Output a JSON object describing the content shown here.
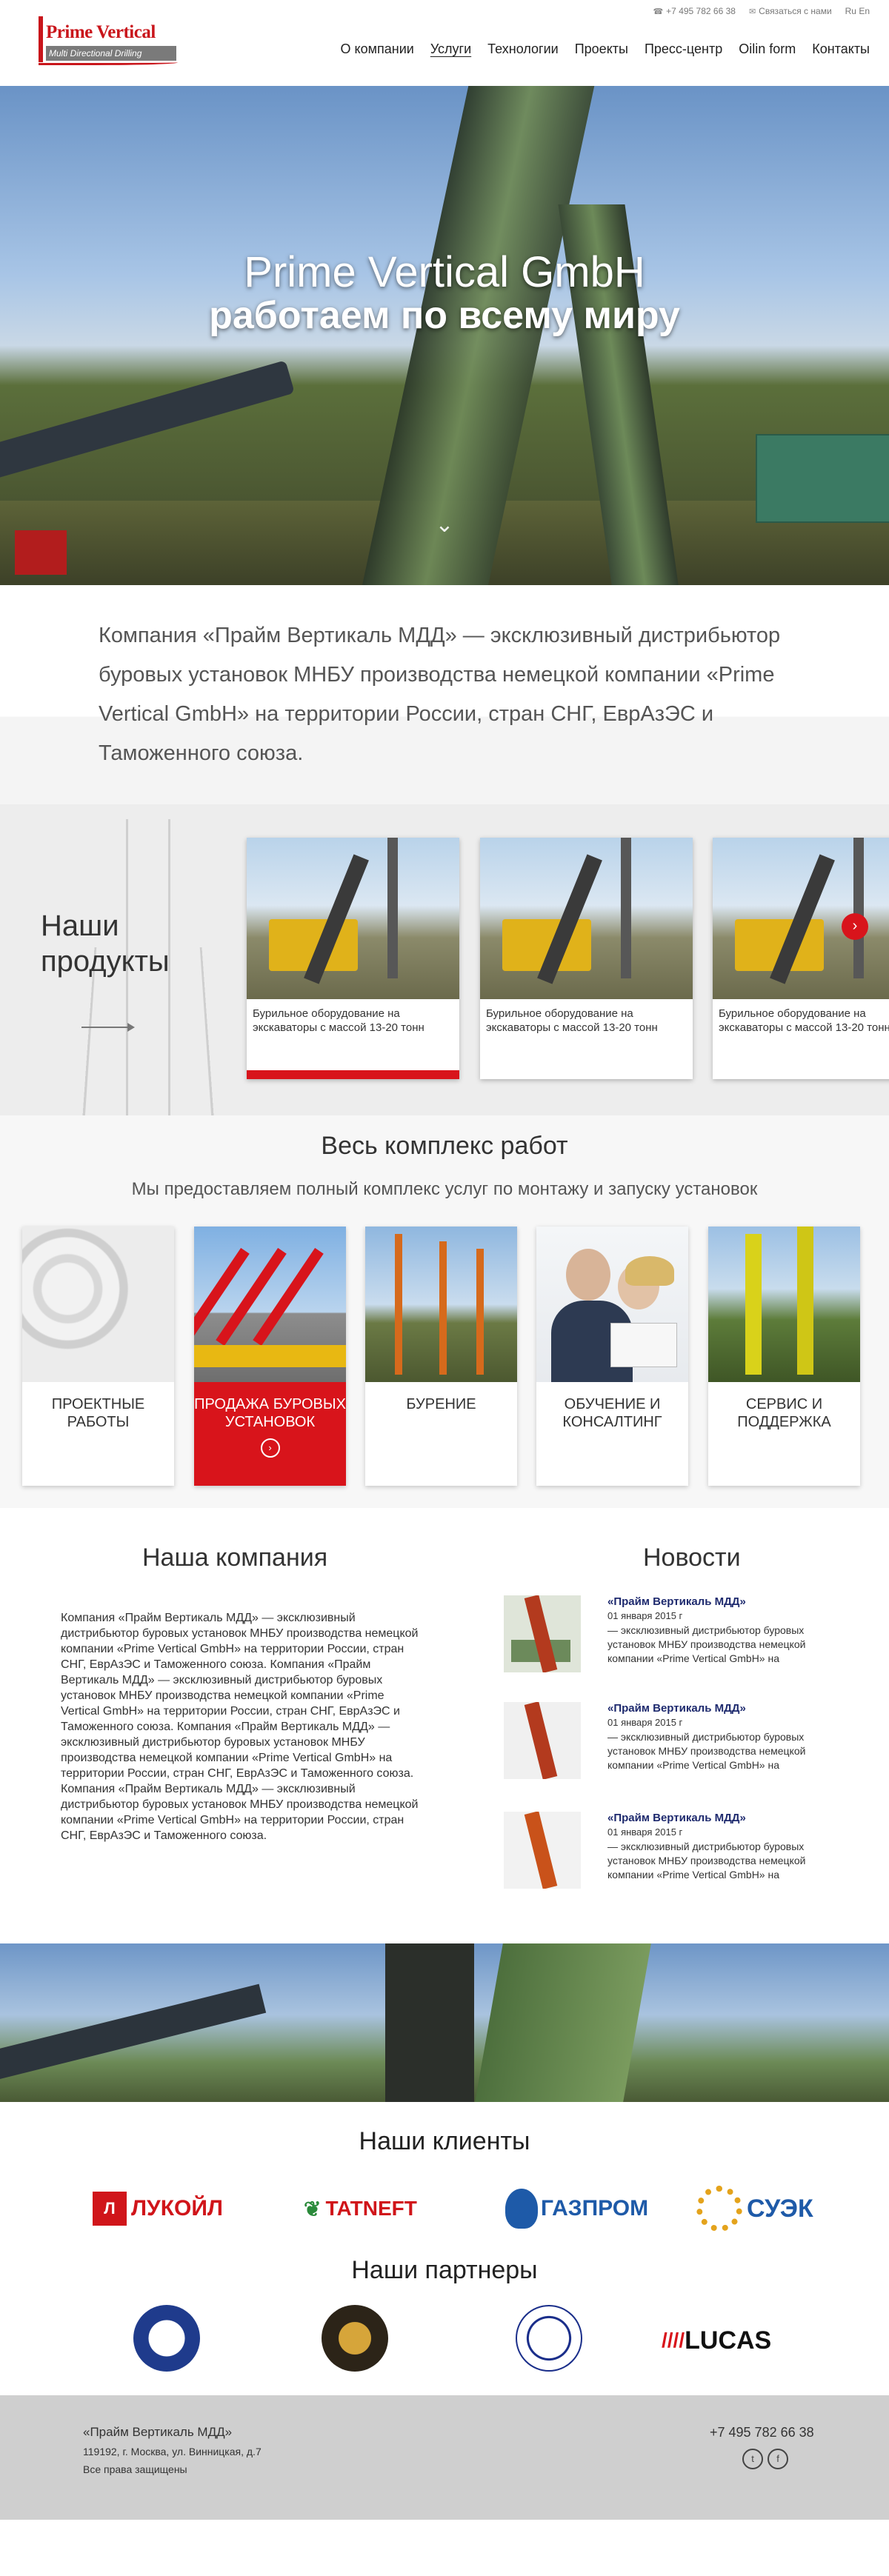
{
  "header": {
    "logo_title": "Prime Vertical",
    "logo_sub": "Multi Directional Drilling",
    "phone": "+7 495 782 66 38",
    "contact": "Связаться с нами",
    "lang": "Ru En",
    "nav": [
      "О компании",
      "Услуги",
      "Технологии",
      "Проекты",
      "Пресс-центр",
      "Oilin form",
      "Контакты"
    ],
    "active_nav_index": 1
  },
  "hero": {
    "title": "Prime Vertical GmbH",
    "subtitle": "работаем по всему миру"
  },
  "intro": {
    "text": "Компания «Прайм Вертикаль МДД» — эксклюзивный дистрибьютор буровых установок МНБУ производства немецкой компании «Prime Vertical GmbH» на территории России, стран СНГ, ЕврАзЭС и Таможенного союза."
  },
  "products": {
    "heading": "Наши продукты",
    "cards": [
      {
        "text": "Бурильное оборудование на экскаваторы с массой 13-20 тонн"
      },
      {
        "text": "Бурильное оборудование на экскаваторы с массой 13-20 тонн"
      },
      {
        "text": "Бурильное оборудование на экскаваторы с массой 13-20 тонн"
      }
    ]
  },
  "services": {
    "heading": "Весь комплекс работ",
    "lead": "Мы предоставляем полный комплекс услуг по монтажу и запуску установок",
    "cards": [
      {
        "label": "ПРОЕКТНЫЕ РАБОТЫ"
      },
      {
        "label": "ПРОДАЖА БУРОВЫХ УСТАНОВОК"
      },
      {
        "label": "БУРЕНИЕ"
      },
      {
        "label": "ОБУЧЕНИЕ И КОНСАЛТИНГ"
      },
      {
        "label": "СЕРВИС И ПОДДЕРЖКА"
      }
    ]
  },
  "company": {
    "heading": "Наша компания",
    "text": "Компания «Прайм Вертикаль МДД» — эксклюзивный дистрибьютор буровых установок МНБУ производства немецкой компании «Prime Vertical GmbH» на территории России, стран СНГ, ЕврАзЭС и Таможенного союза. Компания «Прайм Вертикаль МДД» — эксклюзивный дистрибьютор буровых установок МНБУ производства немецкой компании «Prime Vertical GmbH» на территории России, стран СНГ, ЕврАзЭС и Таможенного союза. Компания «Прайм Вертикаль МДД» — эксклюзивный дистрибьютор буровых установок МНБУ производства немецкой компании «Prime Vertical GmbH» на территории России, стран СНГ, ЕврАзЭС и Таможенного союза. Компания «Прайм Вертикаль МДД» — эксклюзивный дистрибьютор буровых установок МНБУ производства немецкой компании «Prime Vertical GmbH» на территории России, стран СНГ, ЕврАзЭС и Таможенного союза."
  },
  "news": {
    "heading": "Новости",
    "items": [
      {
        "title": "«Прайм Вертикаль МДД»",
        "date": "01 января 2015 г",
        "body": "— эксклюзивный дистрибьютор буровых установок МНБУ производства немецкой компании «Prime Vertical GmbH» на"
      },
      {
        "title": "«Прайм Вертикаль МДД»",
        "date": "01 января 2015 г",
        "body": "— эксклюзивный дистрибьютор буровых установок МНБУ производства немецкой компании «Prime Vertical GmbH» на"
      },
      {
        "title": "«Прайм Вертикаль МДД»",
        "date": "01 января 2015 г",
        "body": "— эксклюзивный дистрибьютор буровых установок МНБУ производства немецкой компании «Prime Vertical GmbH» на"
      }
    ]
  },
  "clients": {
    "heading": "Наши клиенты",
    "logos": [
      "ЛУКОЙЛ",
      "TATNEFT",
      "ГАЗПРОМ",
      "СУЭК"
    ]
  },
  "partners": {
    "heading": "Наши партнеры",
    "logos": [
      "LUCAS"
    ]
  },
  "footer": {
    "name": "«Прайм Вертикаль МДД»",
    "address": "119192, г. Москва, ул. Винницкая, д.7",
    "rights": "Все права защищены",
    "phone": "+7 495 782 66 38"
  },
  "colors": {
    "accent": "#d8141b",
    "footer_bg": "#cfcfcf",
    "news_title": "#1e2a6e"
  }
}
